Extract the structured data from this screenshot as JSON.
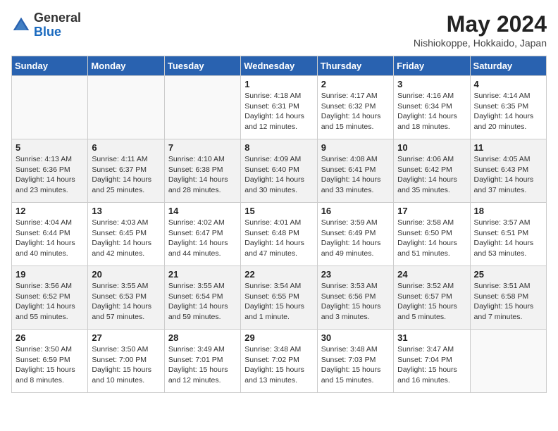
{
  "header": {
    "logo_general": "General",
    "logo_blue": "Blue",
    "month_year": "May 2024",
    "location": "Nishiokoppe, Hokkaido, Japan"
  },
  "days_of_week": [
    "Sunday",
    "Monday",
    "Tuesday",
    "Wednesday",
    "Thursday",
    "Friday",
    "Saturday"
  ],
  "weeks": [
    [
      {
        "day": "",
        "sunrise": "",
        "sunset": "",
        "daylight": ""
      },
      {
        "day": "",
        "sunrise": "",
        "sunset": "",
        "daylight": ""
      },
      {
        "day": "",
        "sunrise": "",
        "sunset": "",
        "daylight": ""
      },
      {
        "day": "1",
        "sunrise": "Sunrise: 4:18 AM",
        "sunset": "Sunset: 6:31 PM",
        "daylight": "Daylight: 14 hours and 12 minutes."
      },
      {
        "day": "2",
        "sunrise": "Sunrise: 4:17 AM",
        "sunset": "Sunset: 6:32 PM",
        "daylight": "Daylight: 14 hours and 15 minutes."
      },
      {
        "day": "3",
        "sunrise": "Sunrise: 4:16 AM",
        "sunset": "Sunset: 6:34 PM",
        "daylight": "Daylight: 14 hours and 18 minutes."
      },
      {
        "day": "4",
        "sunrise": "Sunrise: 4:14 AM",
        "sunset": "Sunset: 6:35 PM",
        "daylight": "Daylight: 14 hours and 20 minutes."
      }
    ],
    [
      {
        "day": "5",
        "sunrise": "Sunrise: 4:13 AM",
        "sunset": "Sunset: 6:36 PM",
        "daylight": "Daylight: 14 hours and 23 minutes."
      },
      {
        "day": "6",
        "sunrise": "Sunrise: 4:11 AM",
        "sunset": "Sunset: 6:37 PM",
        "daylight": "Daylight: 14 hours and 25 minutes."
      },
      {
        "day": "7",
        "sunrise": "Sunrise: 4:10 AM",
        "sunset": "Sunset: 6:38 PM",
        "daylight": "Daylight: 14 hours and 28 minutes."
      },
      {
        "day": "8",
        "sunrise": "Sunrise: 4:09 AM",
        "sunset": "Sunset: 6:40 PM",
        "daylight": "Daylight: 14 hours and 30 minutes."
      },
      {
        "day": "9",
        "sunrise": "Sunrise: 4:08 AM",
        "sunset": "Sunset: 6:41 PM",
        "daylight": "Daylight: 14 hours and 33 minutes."
      },
      {
        "day": "10",
        "sunrise": "Sunrise: 4:06 AM",
        "sunset": "Sunset: 6:42 PM",
        "daylight": "Daylight: 14 hours and 35 minutes."
      },
      {
        "day": "11",
        "sunrise": "Sunrise: 4:05 AM",
        "sunset": "Sunset: 6:43 PM",
        "daylight": "Daylight: 14 hours and 37 minutes."
      }
    ],
    [
      {
        "day": "12",
        "sunrise": "Sunrise: 4:04 AM",
        "sunset": "Sunset: 6:44 PM",
        "daylight": "Daylight: 14 hours and 40 minutes."
      },
      {
        "day": "13",
        "sunrise": "Sunrise: 4:03 AM",
        "sunset": "Sunset: 6:45 PM",
        "daylight": "Daylight: 14 hours and 42 minutes."
      },
      {
        "day": "14",
        "sunrise": "Sunrise: 4:02 AM",
        "sunset": "Sunset: 6:47 PM",
        "daylight": "Daylight: 14 hours and 44 minutes."
      },
      {
        "day": "15",
        "sunrise": "Sunrise: 4:01 AM",
        "sunset": "Sunset: 6:48 PM",
        "daylight": "Daylight: 14 hours and 47 minutes."
      },
      {
        "day": "16",
        "sunrise": "Sunrise: 3:59 AM",
        "sunset": "Sunset: 6:49 PM",
        "daylight": "Daylight: 14 hours and 49 minutes."
      },
      {
        "day": "17",
        "sunrise": "Sunrise: 3:58 AM",
        "sunset": "Sunset: 6:50 PM",
        "daylight": "Daylight: 14 hours and 51 minutes."
      },
      {
        "day": "18",
        "sunrise": "Sunrise: 3:57 AM",
        "sunset": "Sunset: 6:51 PM",
        "daylight": "Daylight: 14 hours and 53 minutes."
      }
    ],
    [
      {
        "day": "19",
        "sunrise": "Sunrise: 3:56 AM",
        "sunset": "Sunset: 6:52 PM",
        "daylight": "Daylight: 14 hours and 55 minutes."
      },
      {
        "day": "20",
        "sunrise": "Sunrise: 3:55 AM",
        "sunset": "Sunset: 6:53 PM",
        "daylight": "Daylight: 14 hours and 57 minutes."
      },
      {
        "day": "21",
        "sunrise": "Sunrise: 3:55 AM",
        "sunset": "Sunset: 6:54 PM",
        "daylight": "Daylight: 14 hours and 59 minutes."
      },
      {
        "day": "22",
        "sunrise": "Sunrise: 3:54 AM",
        "sunset": "Sunset: 6:55 PM",
        "daylight": "Daylight: 15 hours and 1 minute."
      },
      {
        "day": "23",
        "sunrise": "Sunrise: 3:53 AM",
        "sunset": "Sunset: 6:56 PM",
        "daylight": "Daylight: 15 hours and 3 minutes."
      },
      {
        "day": "24",
        "sunrise": "Sunrise: 3:52 AM",
        "sunset": "Sunset: 6:57 PM",
        "daylight": "Daylight: 15 hours and 5 minutes."
      },
      {
        "day": "25",
        "sunrise": "Sunrise: 3:51 AM",
        "sunset": "Sunset: 6:58 PM",
        "daylight": "Daylight: 15 hours and 7 minutes."
      }
    ],
    [
      {
        "day": "26",
        "sunrise": "Sunrise: 3:50 AM",
        "sunset": "Sunset: 6:59 PM",
        "daylight": "Daylight: 15 hours and 8 minutes."
      },
      {
        "day": "27",
        "sunrise": "Sunrise: 3:50 AM",
        "sunset": "Sunset: 7:00 PM",
        "daylight": "Daylight: 15 hours and 10 minutes."
      },
      {
        "day": "28",
        "sunrise": "Sunrise: 3:49 AM",
        "sunset": "Sunset: 7:01 PM",
        "daylight": "Daylight: 15 hours and 12 minutes."
      },
      {
        "day": "29",
        "sunrise": "Sunrise: 3:48 AM",
        "sunset": "Sunset: 7:02 PM",
        "daylight": "Daylight: 15 hours and 13 minutes."
      },
      {
        "day": "30",
        "sunrise": "Sunrise: 3:48 AM",
        "sunset": "Sunset: 7:03 PM",
        "daylight": "Daylight: 15 hours and 15 minutes."
      },
      {
        "day": "31",
        "sunrise": "Sunrise: 3:47 AM",
        "sunset": "Sunset: 7:04 PM",
        "daylight": "Daylight: 15 hours and 16 minutes."
      },
      {
        "day": "",
        "sunrise": "",
        "sunset": "",
        "daylight": ""
      }
    ]
  ]
}
